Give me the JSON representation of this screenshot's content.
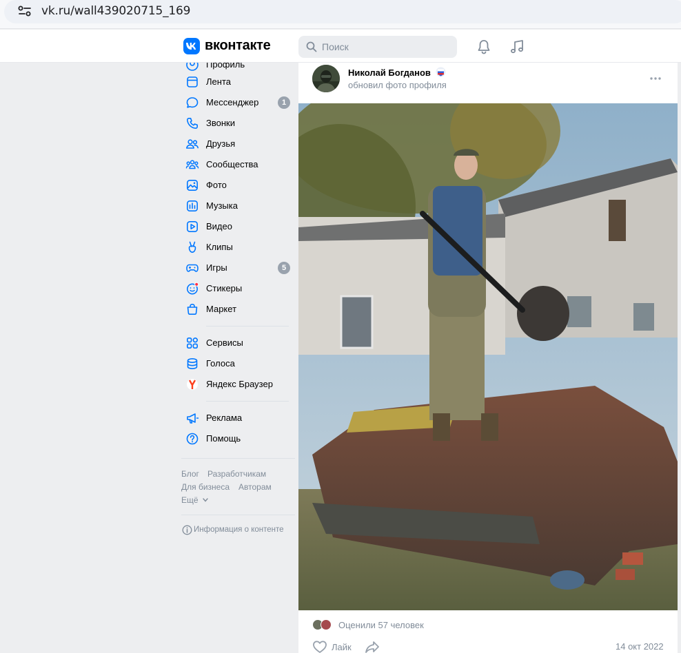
{
  "browser": {
    "url": "vk.ru/wall439020715_169"
  },
  "header": {
    "brand": "вконтакте",
    "search_placeholder": "Поиск",
    "accent": "#0077ff"
  },
  "nav": {
    "partial_top_label": "Профиль",
    "items": [
      {
        "label": "Лента",
        "icon": "newsfeed-icon"
      },
      {
        "label": "Мессенджер",
        "icon": "messenger-icon",
        "badge": "1"
      },
      {
        "label": "Звонки",
        "icon": "phone-icon"
      },
      {
        "label": "Друзья",
        "icon": "friends-icon"
      },
      {
        "label": "Сообщества",
        "icon": "communities-icon"
      },
      {
        "label": "Фото",
        "icon": "photo-icon"
      },
      {
        "label": "Музыка",
        "icon": "music-icon"
      },
      {
        "label": "Видео",
        "icon": "video-icon"
      },
      {
        "label": "Клипы",
        "icon": "clips-icon"
      },
      {
        "label": "Игры",
        "icon": "games-icon",
        "badge": "5"
      },
      {
        "label": "Стикеры",
        "icon": "stickers-icon"
      },
      {
        "label": "Маркет",
        "icon": "market-icon"
      }
    ],
    "items2": [
      {
        "label": "Сервисы",
        "icon": "services-icon"
      },
      {
        "label": "Голоса",
        "icon": "votes-icon"
      },
      {
        "label": "Яндекс Браузер",
        "icon": "yandex-icon"
      }
    ],
    "items3": [
      {
        "label": "Реклама",
        "icon": "ads-icon"
      },
      {
        "label": "Помощь",
        "icon": "help-icon"
      }
    ],
    "footer": {
      "blog": "Блог",
      "developers": "Разработчикам",
      "business": "Для бизнеса",
      "authors": "Авторам",
      "more": "Ещё",
      "content_info": "Информация о контенте"
    }
  },
  "post": {
    "author": "Николай Богданов",
    "action": "обновил фото профиля",
    "likes_text": "Оценили 57 человек",
    "like_label": "Лайк",
    "date": "14 окт 2022"
  }
}
